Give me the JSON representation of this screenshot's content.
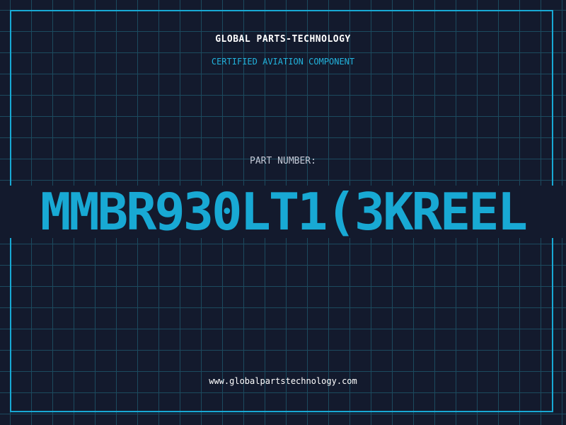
{
  "header": {
    "company_name": "GLOBAL PARTS-TECHNOLOGY",
    "tagline": "CERTIFIED AVIATION COMPONENT"
  },
  "part": {
    "label": "PART NUMBER:",
    "number": "MMBR930LT1(3KREEL"
  },
  "footer": {
    "website": "www.globalpartstechnology.com"
  },
  "colors": {
    "background": "#131a2d",
    "grid": "#1c4a5e",
    "accent": "#18a9d4",
    "text": "#ffffff",
    "label": "#c4c9d6"
  }
}
